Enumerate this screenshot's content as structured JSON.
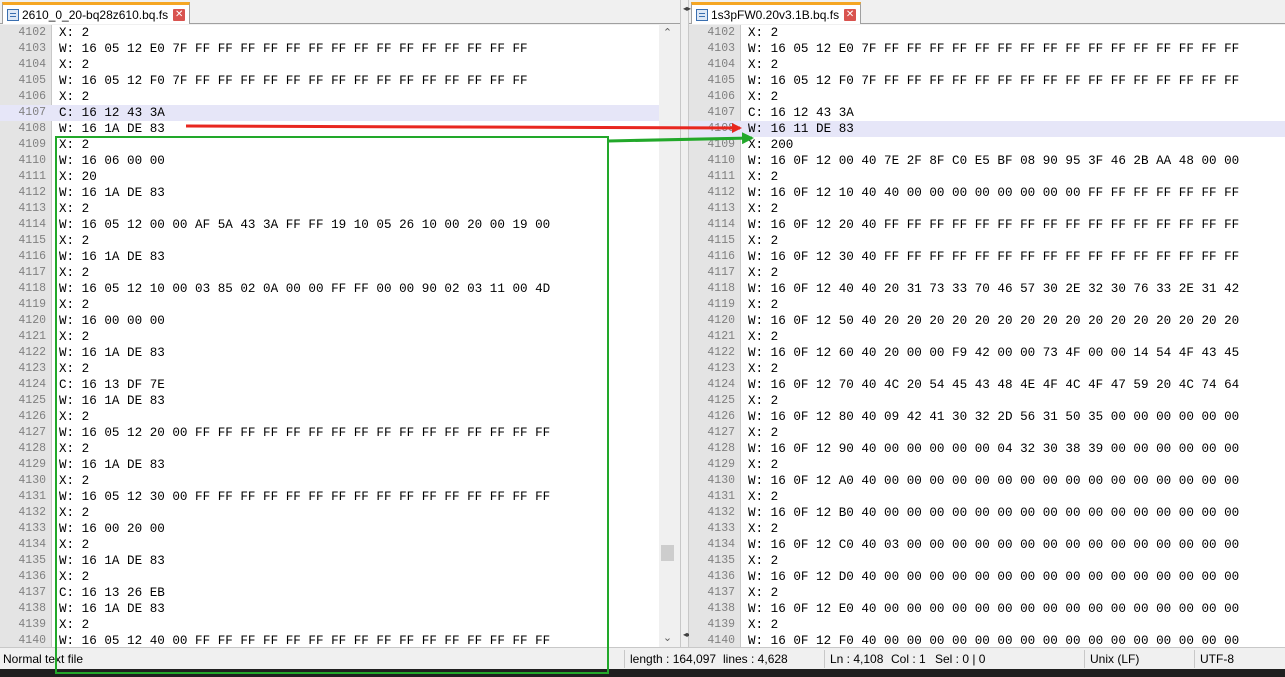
{
  "left_tab": {
    "title": "2610_0_20-bq28z610.bq.fs"
  },
  "right_tab": {
    "title": "1s3pFW0.20v3.1B.bq.fs"
  },
  "left_lines": [
    {
      "n": "4102",
      "t": "X: 2"
    },
    {
      "n": "4103",
      "t": "W: 16 05 12 E0 7F FF FF FF FF FF FF FF FF FF FF FF FF FF FF FF"
    },
    {
      "n": "4104",
      "t": "X: 2"
    },
    {
      "n": "4105",
      "t": "W: 16 05 12 F0 7F FF FF FF FF FF FF FF FF FF FF FF FF FF FF FF"
    },
    {
      "n": "4106",
      "t": "X: 2"
    },
    {
      "n": "4107",
      "t": "C: 16 12 43 3A"
    },
    {
      "n": "4108",
      "t": "W: 16 1A DE 83"
    },
    {
      "n": "4109",
      "t": "X: 2"
    },
    {
      "n": "4110",
      "t": "W: 16 06 00 00"
    },
    {
      "n": "4111",
      "t": "X: 20"
    },
    {
      "n": "4112",
      "t": "W: 16 1A DE 83"
    },
    {
      "n": "4113",
      "t": "X: 2"
    },
    {
      "n": "4114",
      "t": "W: 16 05 12 00 00 AF 5A 43 3A FF FF 19 10 05 26 10 00 20 00 19 00"
    },
    {
      "n": "4115",
      "t": "X: 2"
    },
    {
      "n": "4116",
      "t": "W: 16 1A DE 83"
    },
    {
      "n": "4117",
      "t": "X: 2"
    },
    {
      "n": "4118",
      "t": "W: 16 05 12 10 00 03 85 02 0A 00 00 FF FF 00 00 90 02 03 11 00 4D"
    },
    {
      "n": "4119",
      "t": "X: 2"
    },
    {
      "n": "4120",
      "t": "W: 16 00 00 00"
    },
    {
      "n": "4121",
      "t": "X: 2"
    },
    {
      "n": "4122",
      "t": "W: 16 1A DE 83"
    },
    {
      "n": "4123",
      "t": "X: 2"
    },
    {
      "n": "4124",
      "t": "C: 16 13 DF 7E"
    },
    {
      "n": "4125",
      "t": "W: 16 1A DE 83"
    },
    {
      "n": "4126",
      "t": "X: 2"
    },
    {
      "n": "4127",
      "t": "W: 16 05 12 20 00 FF FF FF FF FF FF FF FF FF FF FF FF FF FF FF FF"
    },
    {
      "n": "4128",
      "t": "X: 2"
    },
    {
      "n": "4129",
      "t": "W: 16 1A DE 83"
    },
    {
      "n": "4130",
      "t": "X: 2"
    },
    {
      "n": "4131",
      "t": "W: 16 05 12 30 00 FF FF FF FF FF FF FF FF FF FF FF FF FF FF FF FF"
    },
    {
      "n": "4132",
      "t": "X: 2"
    },
    {
      "n": "4133",
      "t": "W: 16 00 20 00"
    },
    {
      "n": "4134",
      "t": "X: 2"
    },
    {
      "n": "4135",
      "t": "W: 16 1A DE 83"
    },
    {
      "n": "4136",
      "t": "X: 2"
    },
    {
      "n": "4137",
      "t": "C: 16 13 26 EB"
    },
    {
      "n": "4138",
      "t": "W: 16 1A DE 83"
    },
    {
      "n": "4139",
      "t": "X: 2"
    },
    {
      "n": "4140",
      "t": "W: 16 05 12 40 00 FF FF FF FF FF FF FF FF FF FF FF FF FF FF FF FF"
    }
  ],
  "right_lines": [
    {
      "n": "4102",
      "t": "X: 2"
    },
    {
      "n": "4103",
      "t": "W: 16 05 12 E0 7F FF FF FF FF FF FF FF FF FF FF FF FF FF FF FF FF"
    },
    {
      "n": "4104",
      "t": "X: 2"
    },
    {
      "n": "4105",
      "t": "W: 16 05 12 F0 7F FF FF FF FF FF FF FF FF FF FF FF FF FF FF FF FF"
    },
    {
      "n": "4106",
      "t": "X: 2"
    },
    {
      "n": "4107",
      "t": "C: 16 12 43 3A"
    },
    {
      "n": "4108",
      "t": "W: 16 11 DE 83"
    },
    {
      "n": "4109",
      "t": "X: 200"
    },
    {
      "n": "4110",
      "t": "W: 16 0F 12 00 40 7E 2F 8F C0 E5 BF 08 90 95 3F 46 2B AA 48 00 00"
    },
    {
      "n": "4111",
      "t": "X: 2"
    },
    {
      "n": "4112",
      "t": "W: 16 0F 12 10 40 40 00 00 00 00 00 00 00 00 FF FF FF FF FF FF FF"
    },
    {
      "n": "4113",
      "t": "X: 2"
    },
    {
      "n": "4114",
      "t": "W: 16 0F 12 20 40 FF FF FF FF FF FF FF FF FF FF FF FF FF FF FF FF"
    },
    {
      "n": "4115",
      "t": "X: 2"
    },
    {
      "n": "4116",
      "t": "W: 16 0F 12 30 40 FF FF FF FF FF FF FF FF FF FF FF FF FF FF FF FF"
    },
    {
      "n": "4117",
      "t": "X: 2"
    },
    {
      "n": "4118",
      "t": "W: 16 0F 12 40 40 20 31 73 33 70 46 57 30 2E 32 30 76 33 2E 31 42"
    },
    {
      "n": "4119",
      "t": "X: 2"
    },
    {
      "n": "4120",
      "t": "W: 16 0F 12 50 40 20 20 20 20 20 20 20 20 20 20 20 20 20 20 20 20"
    },
    {
      "n": "4121",
      "t": "X: 2"
    },
    {
      "n": "4122",
      "t": "W: 16 0F 12 60 40 20 00 00 F9 42 00 00 73 4F 00 00 14 54 4F 43 45"
    },
    {
      "n": "4123",
      "t": "X: 2"
    },
    {
      "n": "4124",
      "t": "W: 16 0F 12 70 40 4C 20 54 45 43 48 4E 4F 4C 4F 47 59 20 4C 74 64"
    },
    {
      "n": "4125",
      "t": "X: 2"
    },
    {
      "n": "4126",
      "t": "W: 16 0F 12 80 40 09 42 41 30 32 2D 56 31 50 35 00 00 00 00 00 00"
    },
    {
      "n": "4127",
      "t": "X: 2"
    },
    {
      "n": "4128",
      "t": "W: 16 0F 12 90 40 00 00 00 00 00 04 32 30 38 39 00 00 00 00 00 00"
    },
    {
      "n": "4129",
      "t": "X: 2"
    },
    {
      "n": "4130",
      "t": "W: 16 0F 12 A0 40 00 00 00 00 00 00 00 00 00 00 00 00 00 00 00 00"
    },
    {
      "n": "4131",
      "t": "X: 2"
    },
    {
      "n": "4132",
      "t": "W: 16 0F 12 B0 40 00 00 00 00 00 00 00 00 00 00 00 00 00 00 00 00"
    },
    {
      "n": "4133",
      "t": "X: 2"
    },
    {
      "n": "4134",
      "t": "W: 16 0F 12 C0 40 03 00 00 00 00 00 00 00 00 00 00 00 00 00 00 00"
    },
    {
      "n": "4135",
      "t": "X: 2"
    },
    {
      "n": "4136",
      "t": "W: 16 0F 12 D0 40 00 00 00 00 00 00 00 00 00 00 00 00 00 00 00 00"
    },
    {
      "n": "4137",
      "t": "X: 2"
    },
    {
      "n": "4138",
      "t": "W: 16 0F 12 E0 40 00 00 00 00 00 00 00 00 00 00 00 00 00 00 00 00"
    },
    {
      "n": "4139",
      "t": "X: 2"
    },
    {
      "n": "4140",
      "t": "W: 16 0F 12 F0 40 00 00 00 00 00 00 00 00 00 00 00 00 00 00 00 00"
    }
  ],
  "left_highlight_line": "4107",
  "right_highlight_line": "4108",
  "status": {
    "file_type": "Normal text file",
    "length": "length : 164,097",
    "lines": "lines : 4,628",
    "position": "Ln : 4,108",
    "column": "Col : 1",
    "selection": "Sel : 0 | 0",
    "eol": "Unix (LF)",
    "encoding": "UTF-8"
  },
  "icons": {
    "tab_file": "file-icon",
    "tab_close": "close-icon",
    "scroll_up": "chevron-up-icon",
    "scroll_down": "chevron-down-icon"
  },
  "colors": {
    "tab_accent": "#f5a623",
    "red_arrow": "#e8271f",
    "green_annotation": "#22a82a",
    "highlight": "#e6e6f8"
  },
  "left_scroll_position": 0.88
}
